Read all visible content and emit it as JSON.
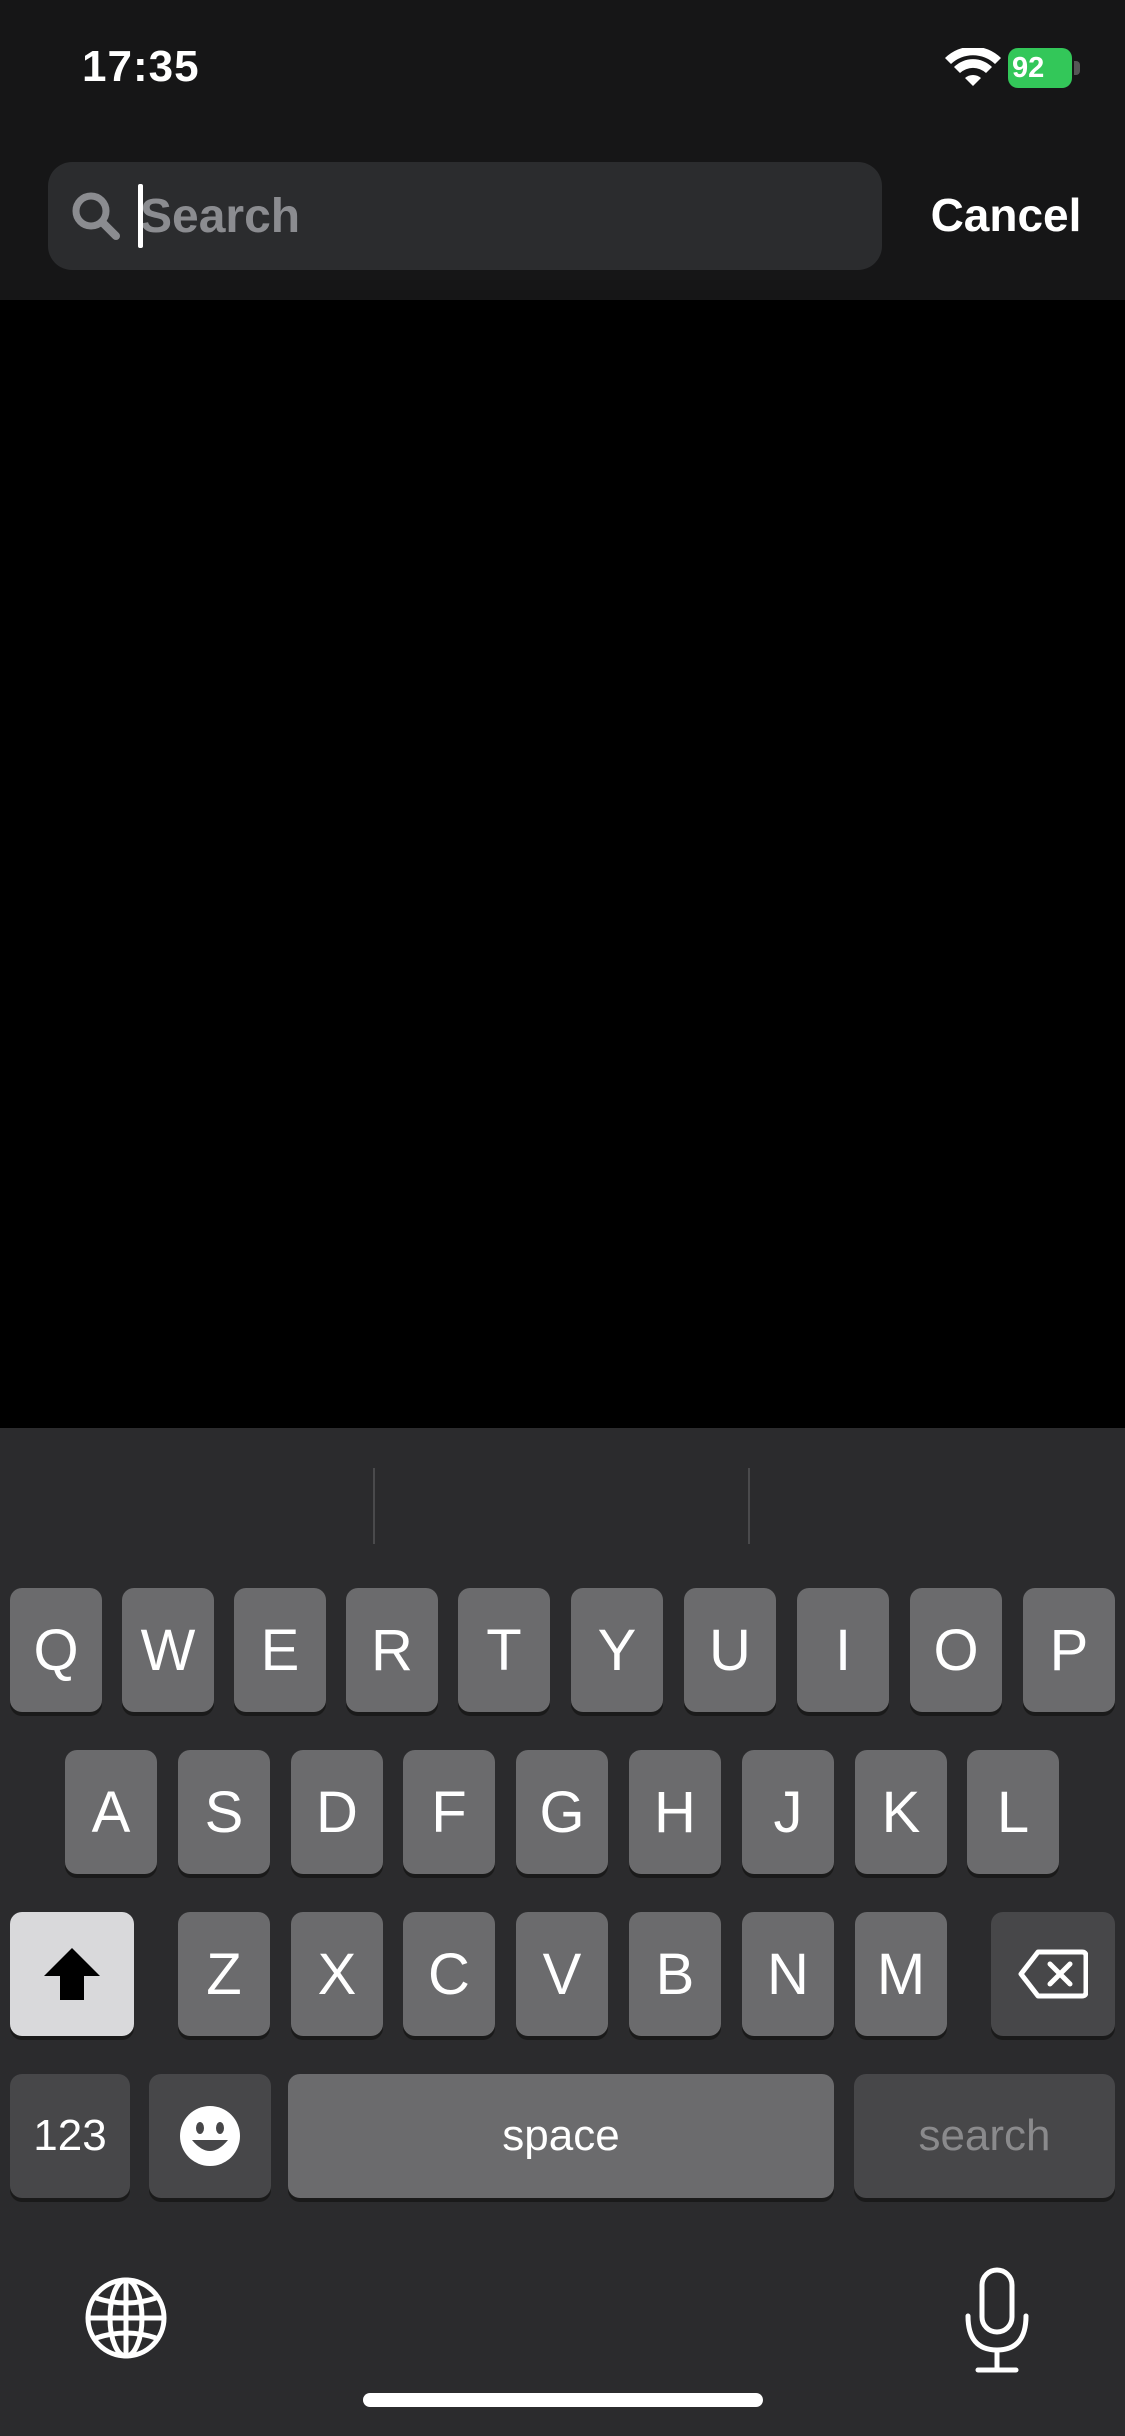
{
  "status_bar": {
    "time": "17:35",
    "battery": "92"
  },
  "search": {
    "placeholder": "Search",
    "value": "",
    "cancel_label": "Cancel"
  },
  "keyboard": {
    "row1": [
      "Q",
      "W",
      "E",
      "R",
      "T",
      "Y",
      "U",
      "I",
      "O",
      "P"
    ],
    "row2": [
      "A",
      "S",
      "D",
      "F",
      "G",
      "H",
      "J",
      "K",
      "L"
    ],
    "row3": [
      "Z",
      "X",
      "C",
      "V",
      "B",
      "N",
      "M"
    ],
    "numbers_label": "123",
    "space_label": "space",
    "search_label": "search"
  },
  "icons": [
    "wifi-icon",
    "battery-icon",
    "search-icon",
    "shift-icon",
    "backspace-icon",
    "emoji-icon",
    "globe-icon",
    "microphone-icon"
  ]
}
